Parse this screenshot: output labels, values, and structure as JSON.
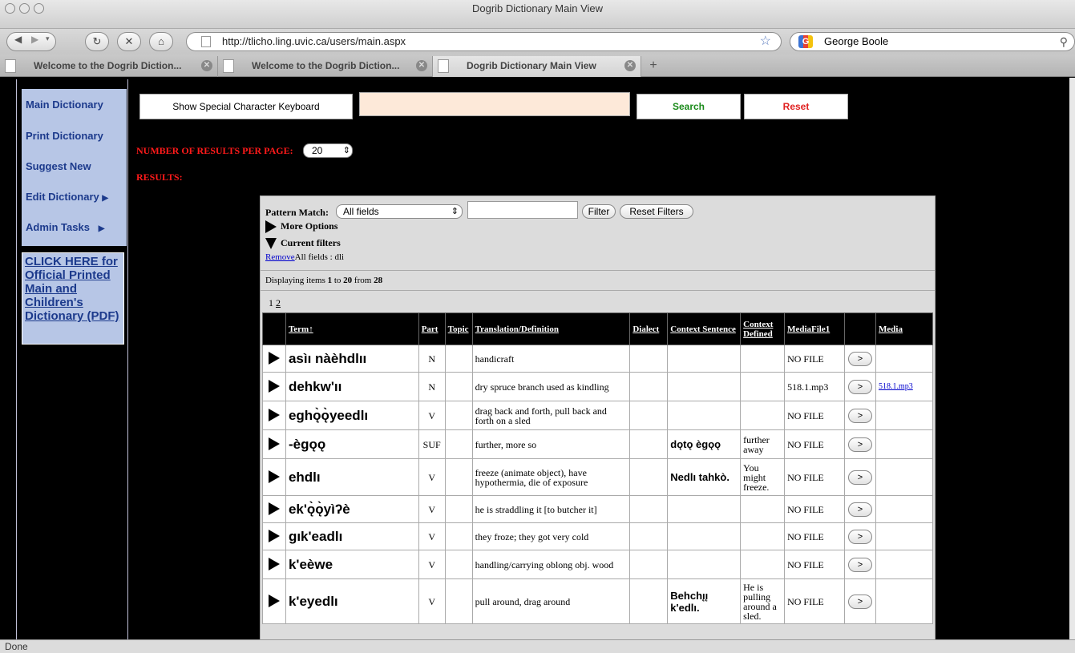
{
  "browser": {
    "window_title": "Dogrib Dictionary Main View",
    "url": "http://tlicho.ling.uvic.ca/users/main.aspx",
    "search_engine_text": "George Boole",
    "tabs": [
      {
        "label": "Welcome to the Dogrib Diction..."
      },
      {
        "label": "Welcome to the Dogrib Diction..."
      },
      {
        "label": "Dogrib Dictionary Main View"
      }
    ],
    "status": "Done"
  },
  "sidebar": {
    "items": [
      {
        "label": "Main Dictionary"
      },
      {
        "label": "Print Dictionary"
      },
      {
        "label": "Suggest New"
      },
      {
        "label": "Edit Dictionary"
      },
      {
        "label": "Admin Tasks"
      }
    ],
    "pdf_link": "CLICK HERE for Official Printed Main and Children's Dictionary (PDF)"
  },
  "search": {
    "keyboard_button": "Show Special Character Keyboard",
    "search_button": "Search",
    "reset_button": "Reset",
    "search_color": "#1a8a1a",
    "reset_color": "#e02020"
  },
  "results": {
    "per_page_label": "NUMBER OF RESULTS PER PAGE:",
    "per_page_value": "20",
    "results_label": "RESULTS:"
  },
  "grid": {
    "pattern_label": "Pattern Match:",
    "pattern_value": "All fields",
    "filter_button": "Filter",
    "reset_filters_button": "Reset Filters",
    "more_options": "More Options",
    "current_filters": "Current filters",
    "remove_link": "Remove",
    "filter_text": "All fields : dli",
    "display_prefix": "Displaying items ",
    "display_from": "1",
    "display_to_word": " to ",
    "display_to": "20",
    "display_from_word": " from ",
    "display_total": "28",
    "page_current": "1",
    "page_next": "2",
    "columns": [
      "Term",
      "Part",
      "Topic",
      "Translation/Definition",
      "Dialect",
      "Context Sentence",
      "Context Defined",
      "MediaFile1",
      "Media"
    ],
    "sort_arrow": "↑",
    "button_glyph": ">",
    "rows": [
      {
        "term": "asìı nàèhdlıı",
        "part": "N",
        "topic": "",
        "translation": "handicraft",
        "dialect": "",
        "context_sentence": "",
        "context_defined": "",
        "mediafile": "NO FILE",
        "media": ""
      },
      {
        "term": "dehkw'ıı",
        "part": "N",
        "topic": "",
        "translation": "dry spruce branch used as kindling",
        "dialect": "",
        "context_sentence": "",
        "context_defined": "",
        "mediafile": "518.1.mp3",
        "media": "518.1.mp3"
      },
      {
        "term": "eghǫ̀ǫ̀yeedlı",
        "part": "V",
        "topic": "",
        "translation": "drag back and forth, pull back and forth on a sled",
        "dialect": "",
        "context_sentence": "",
        "context_defined": "",
        "mediafile": "NO FILE",
        "media": ""
      },
      {
        "term": "-ègǫǫ",
        "part": "SUF",
        "topic": "",
        "translation": "further, more so",
        "dialect": "",
        "context_sentence": "dǫtǫ ègǫǫ",
        "context_defined": "further away",
        "mediafile": "NO FILE",
        "media": ""
      },
      {
        "term": "ehdlı",
        "part": "V",
        "topic": "",
        "translation": "freeze (animate object), have hypothermia, die of exposure",
        "dialect": "",
        "context_sentence": "Nedlı tahkò.",
        "context_defined": "You might freeze.",
        "mediafile": "NO FILE",
        "media": ""
      },
      {
        "term": "ek'ǫ̀ǫ̀yìʔè",
        "part": "V",
        "topic": "",
        "translation": "he is straddling it [to butcher it]",
        "dialect": "",
        "context_sentence": "",
        "context_defined": "",
        "mediafile": "NO FILE",
        "media": ""
      },
      {
        "term": "gık'eadlı",
        "part": "V",
        "topic": "",
        "translation": "they froze; they got very cold",
        "dialect": "",
        "context_sentence": "",
        "context_defined": "",
        "mediafile": "NO FILE",
        "media": ""
      },
      {
        "term": "k'eèwe",
        "part": "V",
        "topic": "",
        "translation": "handling/carrying oblong obj. wood",
        "dialect": "",
        "context_sentence": "",
        "context_defined": "",
        "mediafile": "NO FILE",
        "media": ""
      },
      {
        "term": "k'eyedlı",
        "part": "V",
        "topic": "",
        "translation": "pull around, drag around",
        "dialect": "",
        "context_sentence": "Behchı̨ı̨ k'edlı.",
        "context_defined": "He is pulling around a sled.",
        "mediafile": "NO FILE",
        "media": ""
      }
    ]
  }
}
